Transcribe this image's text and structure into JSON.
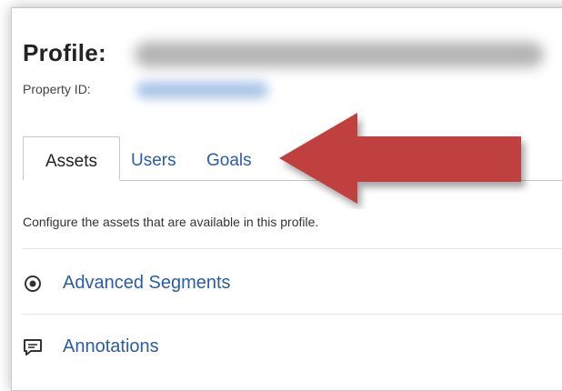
{
  "profile": {
    "title": "Profile:",
    "property_id_label": "Property ID:"
  },
  "tabs": [
    {
      "label": "Assets",
      "active": true
    },
    {
      "label": "Users",
      "active": false
    },
    {
      "label": "Goals",
      "active": false
    }
  ],
  "description": "Configure the assets that are available in this profile.",
  "assets": [
    {
      "label": "Advanced Segments",
      "icon": "radio-target-icon"
    },
    {
      "label": "Annotations",
      "icon": "comment-icon"
    }
  ],
  "colors": {
    "link": "#2a5ca8",
    "arrow": "#c0413f"
  }
}
